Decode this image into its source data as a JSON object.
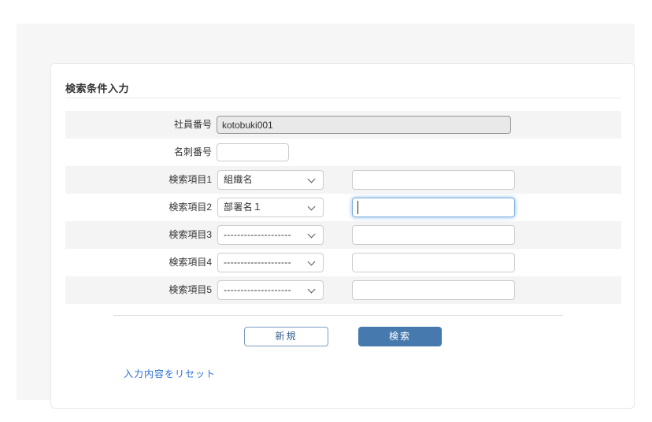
{
  "header": {
    "title": "検索条件入力"
  },
  "form": {
    "employee": {
      "label": "社員番号",
      "value": "kotobuki001"
    },
    "card_number": {
      "label": "名刺番号",
      "value": ""
    },
    "search_items": [
      {
        "label": "検索項目1",
        "select_value": "組織名",
        "input_value": ""
      },
      {
        "label": "検索項目2",
        "select_value": "部署名１",
        "input_value": ""
      },
      {
        "label": "検索項目3",
        "select_value": "--------------------",
        "input_value": ""
      },
      {
        "label": "検索項目4",
        "select_value": "--------------------",
        "input_value": ""
      },
      {
        "label": "検索項目5",
        "select_value": "--------------------",
        "input_value": ""
      }
    ]
  },
  "actions": {
    "new_button": "新規",
    "search_button": "検索",
    "reset_link": "入力内容をリセット"
  },
  "colors": {
    "accent_blue": "#4679ae",
    "link_blue": "#2e6fd9",
    "focus_border_blue": "#79ade1",
    "band_gray": "#f4f4f5",
    "readonly_gray": "#e9e9e9"
  }
}
